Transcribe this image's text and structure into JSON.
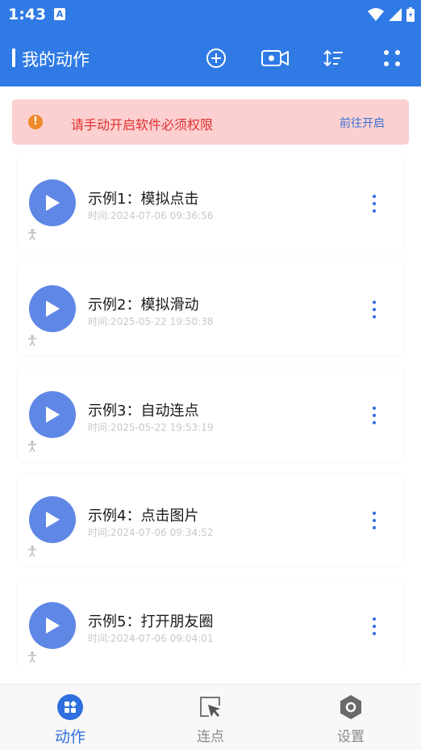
{
  "status_bar": {
    "time": "1:43",
    "badge_letter": "A"
  },
  "app_bar": {
    "title": "我的动作",
    "icons": [
      "add-circle-icon",
      "video-record-icon",
      "sort-icon",
      "grid-dots-icon"
    ]
  },
  "banner": {
    "message": "请手动开启软件必须权限",
    "action_label": "前往开启",
    "icon_glyph": "!"
  },
  "actions": [
    {
      "name": "示例1：模拟点击",
      "time": "时间:2024-07-06 09:36:56"
    },
    {
      "name": "示例2：模拟滑动",
      "time": "时间:2025-05-22 19:50:38"
    },
    {
      "name": "示例3：自动连点",
      "time": "时间:2025-05-22 19:53:19"
    },
    {
      "name": "示例4：点击图片",
      "time": "时间:2024-07-06 09:34:52"
    },
    {
      "name": "示例5：打开朋友圈",
      "time": "时间:2024-07-06 09:04:01"
    }
  ],
  "bottom_nav": [
    {
      "label": "动作",
      "icon": "actions-grid-icon",
      "active": true
    },
    {
      "label": "连点",
      "icon": "cursor-click-icon",
      "active": false
    },
    {
      "label": "设置",
      "icon": "settings-hex-icon",
      "active": false
    }
  ],
  "colors": {
    "primary": "#2f7ae5",
    "play_button": "#5f87e6",
    "banner_bg": "#fcd0d0",
    "banner_text": "#e03030",
    "link": "#3a72d6"
  }
}
